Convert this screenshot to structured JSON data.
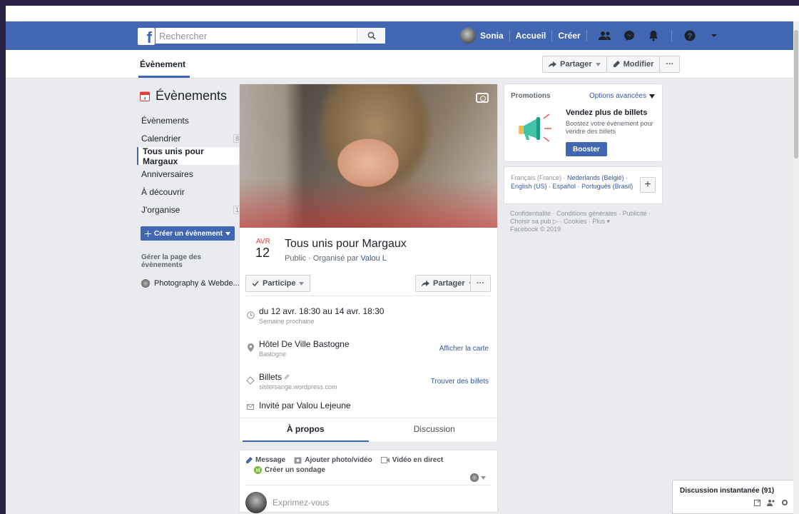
{
  "topbar": {
    "logo": "f",
    "search_placeholder": "Rechercher",
    "user_name": "Sonia",
    "home": "Accueil",
    "create": "Créer"
  },
  "subnav": {
    "title": "Évènement",
    "share": "Partager",
    "edit": "Modifier",
    "more": "···"
  },
  "sidebar": {
    "heading": "Évènements",
    "items": [
      {
        "label": "Évènements",
        "count": ""
      },
      {
        "label": "Calendrier",
        "count": "8"
      },
      {
        "label": "Tous unis pour Margaux",
        "count": ""
      },
      {
        "label": "Anniversaires",
        "count": ""
      },
      {
        "label": "À découvrir",
        "count": ""
      },
      {
        "label": "J'organise",
        "count": "1"
      }
    ],
    "create_button": "Créer un évènement",
    "manage_label": "Gérer la page des évènements",
    "page_name": "Photography & Webde..."
  },
  "event": {
    "month": "AVR",
    "day": "12",
    "title": "Tous unis pour Margaux",
    "visibility": "Public · Organisé par",
    "organizer": "Valou L",
    "going": "Participe",
    "share": "Partager",
    "more": "···",
    "when_main": "du 12 avr. 18:30 au 14 avr. 18:30",
    "when_sub": "Semaine prochaine",
    "where_main": "Hôtel De Ville Bastogne",
    "where_sub": "Bastogne",
    "map_link": "Afficher la carte",
    "tickets_main": "Billets",
    "tickets_sub": "sistersange.wordpress.com",
    "tickets_link": "Trouver des billets",
    "invited": "Invité par Valou Lejeune",
    "tab_about": "À propos",
    "tab_discussion": "Discussion"
  },
  "composer": {
    "message": "Message",
    "photo": "Ajouter photo/vidéo",
    "live": "Vidéo en direct",
    "poll": "Créer un sondage",
    "placeholder": "Exprimez-vous"
  },
  "promo": {
    "heading": "Promotions",
    "options": "Options avancées",
    "title": "Vendez plus de billets",
    "desc": "Boostez votre évènement pour vendre des billets",
    "boost": "Booster"
  },
  "languages": {
    "current": "Français (France) ·",
    "links": [
      "Nederlands (België) ·",
      "English (US)",
      "· Español ·",
      "Português (Brasil)"
    ]
  },
  "footer": {
    "text": "Confidentialité · Conditions générales · Publicité · Choisir sa pub ▷ · Cookies · Plus ▾",
    "copyright": "Facebook © 2019"
  },
  "chat": {
    "label": "Discussion instantanée (91)"
  },
  "colors": {
    "brand": "#4267b2",
    "link": "#365899",
    "date_red": "#e53935"
  }
}
